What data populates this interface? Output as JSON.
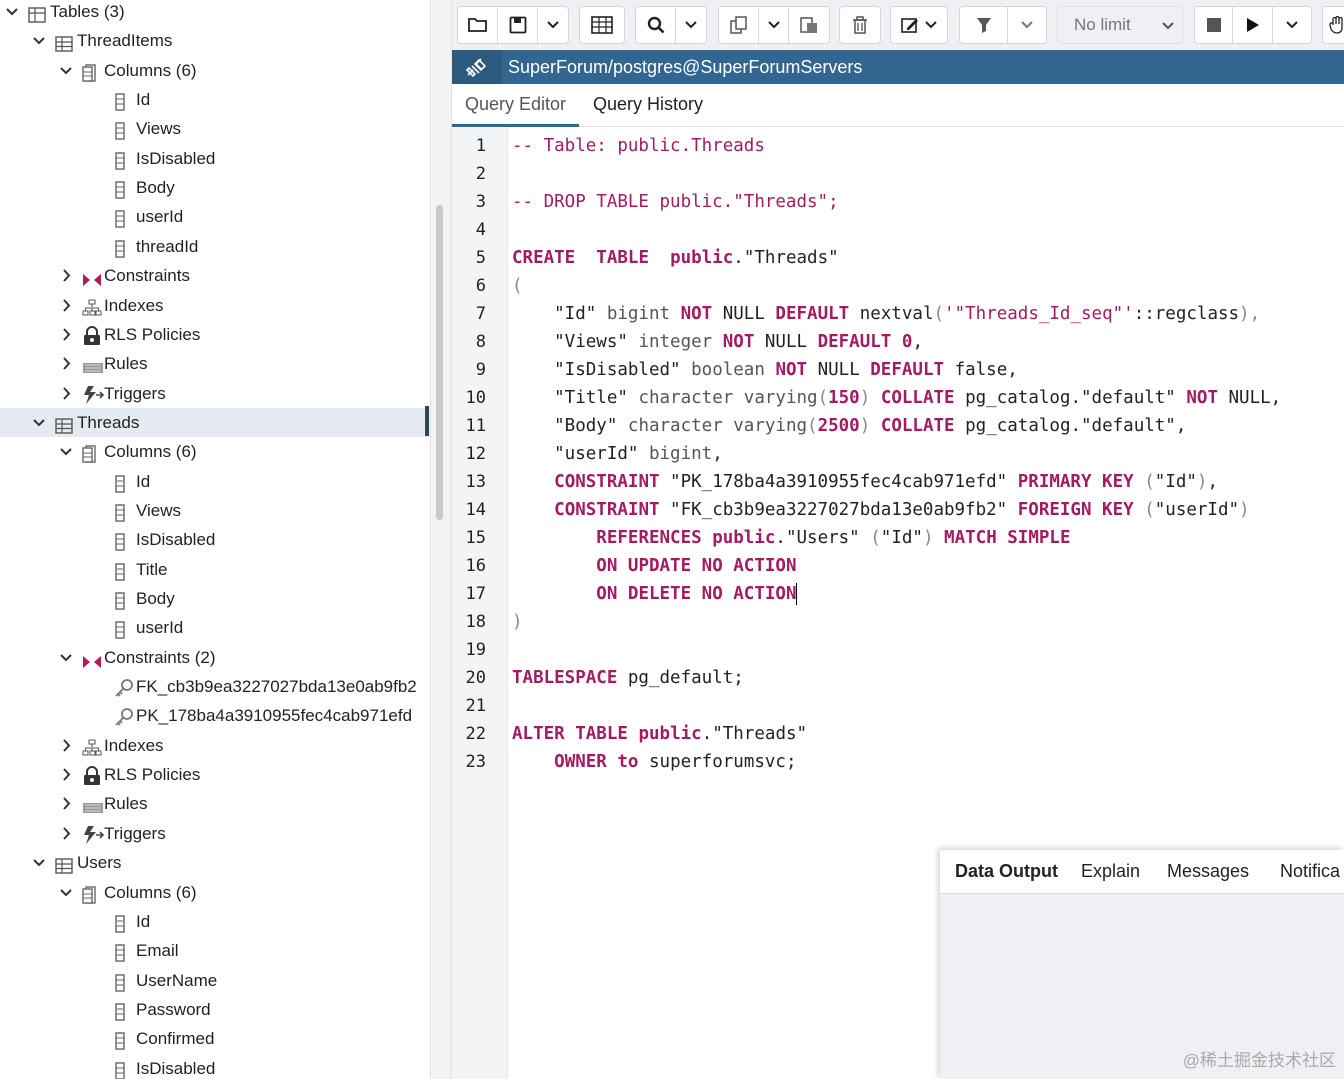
{
  "tree": {
    "rows": [
      {
        "label": "Tables (3)",
        "type": "table-group",
        "expanded": true
      },
      {
        "label": "ThreadItems",
        "type": "table",
        "expanded": true
      },
      {
        "label": "Columns (6)",
        "type": "columns",
        "expanded": true
      },
      {
        "label": "Id",
        "type": "column"
      },
      {
        "label": "Views",
        "type": "column"
      },
      {
        "label": "IsDisabled",
        "type": "column"
      },
      {
        "label": "Body",
        "type": "column"
      },
      {
        "label": "userId",
        "type": "column"
      },
      {
        "label": "threadId",
        "type": "column"
      },
      {
        "label": "Constraints",
        "type": "constraints",
        "expanded": false
      },
      {
        "label": "Indexes",
        "type": "indexes",
        "expanded": false
      },
      {
        "label": "RLS Policies",
        "type": "rls",
        "expanded": false
      },
      {
        "label": "Rules",
        "type": "rules",
        "expanded": false
      },
      {
        "label": "Triggers",
        "type": "triggers",
        "expanded": false
      },
      {
        "label": "Threads",
        "type": "table",
        "expanded": true,
        "selected": true
      },
      {
        "label": "Columns (6)",
        "type": "columns",
        "expanded": true
      },
      {
        "label": "Id",
        "type": "column"
      },
      {
        "label": "Views",
        "type": "column"
      },
      {
        "label": "IsDisabled",
        "type": "column"
      },
      {
        "label": "Title",
        "type": "column"
      },
      {
        "label": "Body",
        "type": "column"
      },
      {
        "label": "userId",
        "type": "column"
      },
      {
        "label": "Constraints (2)",
        "type": "constraints",
        "expanded": true
      },
      {
        "label": "FK_cb3b9ea3227027bda13e0ab9fb2",
        "type": "key"
      },
      {
        "label": "PK_178ba4a3910955fec4cab971efd",
        "type": "key"
      },
      {
        "label": "Indexes",
        "type": "indexes",
        "expanded": false
      },
      {
        "label": "RLS Policies",
        "type": "rls",
        "expanded": false
      },
      {
        "label": "Rules",
        "type": "rules",
        "expanded": false
      },
      {
        "label": "Triggers",
        "type": "triggers",
        "expanded": false
      },
      {
        "label": "Users",
        "type": "table",
        "expanded": true
      },
      {
        "label": "Columns (6)",
        "type": "columns",
        "expanded": true
      },
      {
        "label": "Id",
        "type": "column"
      },
      {
        "label": "Email",
        "type": "column"
      },
      {
        "label": "UserName",
        "type": "column"
      },
      {
        "label": "Password",
        "type": "column"
      },
      {
        "label": "Confirmed",
        "type": "column"
      },
      {
        "label": "IsDisabled",
        "type": "column"
      }
    ]
  },
  "toolbar": {
    "limit_label": "No limit"
  },
  "connection": {
    "title": "SuperForum/postgres@SuperForumServers"
  },
  "tabs": [
    {
      "label": "Query Editor",
      "active": true
    },
    {
      "label": "Query History",
      "active": false
    }
  ],
  "editor": {
    "line_numbers": [
      "1",
      "2",
      "3",
      "4",
      "5",
      "6",
      "7",
      "8",
      "9",
      "10",
      "11",
      "12",
      "13",
      "14",
      "15",
      "16",
      "17",
      "18",
      "19",
      "20",
      "21",
      "22",
      "23"
    ],
    "lines": [
      [
        [
          "cm",
          "-- Table: public.Threads"
        ]
      ],
      [],
      [
        [
          "cm",
          "-- DROP TABLE public.\"Threads\";"
        ]
      ],
      [],
      [
        [
          "kw",
          "CREATE"
        ],
        [
          "",
          "  "
        ],
        [
          "kw",
          "TABLE"
        ],
        [
          "",
          "  "
        ],
        [
          "kw",
          "public"
        ],
        [
          "",
          ".\"Threads\""
        ]
      ],
      [
        [
          "pn",
          "("
        ]
      ],
      [
        [
          "",
          "    \"Id\" "
        ],
        [
          "ty",
          "bigint"
        ],
        [
          "",
          " "
        ],
        [
          "kw",
          "NOT"
        ],
        [
          "",
          " NULL "
        ],
        [
          "kw",
          "DEFAULT"
        ],
        [
          "",
          " nextval"
        ],
        [
          "pn",
          "("
        ],
        [
          "st",
          "'\"Threads_Id_seq\"'"
        ],
        [
          "",
          "::regclass"
        ],
        [
          "pn",
          "),"
        ]
      ],
      [
        [
          "",
          "    \"Views\" "
        ],
        [
          "ty",
          "integer"
        ],
        [
          "",
          " "
        ],
        [
          "kw",
          "NOT"
        ],
        [
          "",
          " NULL "
        ],
        [
          "kw",
          "DEFAULT"
        ],
        [
          "",
          " "
        ],
        [
          "nm",
          "0"
        ],
        [
          "",
          ","
        ]
      ],
      [
        [
          "",
          "    \"IsDisabled\" "
        ],
        [
          "ty",
          "boolean"
        ],
        [
          "",
          " "
        ],
        [
          "kw",
          "NOT"
        ],
        [
          "",
          " NULL "
        ],
        [
          "kw",
          "DEFAULT"
        ],
        [
          "",
          " false,"
        ]
      ],
      [
        [
          "",
          "    \"Title\" "
        ],
        [
          "ty",
          "character varying"
        ],
        [
          "pn",
          "("
        ],
        [
          "nm",
          "150"
        ],
        [
          "pn",
          ")"
        ],
        [
          "",
          " "
        ],
        [
          "kw",
          "COLLATE"
        ],
        [
          "",
          " pg_catalog.\"default\" "
        ],
        [
          "kw",
          "NOT"
        ],
        [
          "",
          " NULL,"
        ]
      ],
      [
        [
          "",
          "    \"Body\" "
        ],
        [
          "ty",
          "character varying"
        ],
        [
          "pn",
          "("
        ],
        [
          "nm",
          "2500"
        ],
        [
          "pn",
          ")"
        ],
        [
          "",
          " "
        ],
        [
          "kw",
          "COLLATE"
        ],
        [
          "",
          " pg_catalog.\"default\","
        ]
      ],
      [
        [
          "",
          "    \"userId\" "
        ],
        [
          "ty",
          "bigint"
        ],
        [
          "",
          ","
        ]
      ],
      [
        [
          "",
          "    "
        ],
        [
          "kw",
          "CONSTRAINT"
        ],
        [
          "",
          " \"PK_178ba4a3910955fec4cab971efd\" "
        ],
        [
          "kw",
          "PRIMARY KEY"
        ],
        [
          "",
          " "
        ],
        [
          "pn",
          "("
        ],
        [
          "",
          "\"Id\""
        ],
        [
          "pn",
          ")"
        ],
        [
          "",
          ","
        ]
      ],
      [
        [
          "",
          "    "
        ],
        [
          "kw",
          "CONSTRAINT"
        ],
        [
          "",
          " \"FK_cb3b9ea3227027bda13e0ab9fb2\" "
        ],
        [
          "kw",
          "FOREIGN KEY"
        ],
        [
          "",
          " "
        ],
        [
          "pn",
          "("
        ],
        [
          "",
          "\"userId\""
        ],
        [
          "pn",
          ")"
        ]
      ],
      [
        [
          "",
          "        "
        ],
        [
          "kw",
          "REFERENCES"
        ],
        [
          "",
          " "
        ],
        [
          "kw",
          "public"
        ],
        [
          "",
          ".\"Users\" "
        ],
        [
          "pn",
          "("
        ],
        [
          "",
          "\"Id\""
        ],
        [
          "pn",
          ")"
        ],
        [
          "",
          " "
        ],
        [
          "kw",
          "MATCH SIMPLE"
        ]
      ],
      [
        [
          "",
          "        "
        ],
        [
          "kw",
          "ON UPDATE NO ACTION"
        ]
      ],
      [
        [
          "",
          "        "
        ],
        [
          "kw",
          "ON DELETE NO ACTION"
        ]
      ],
      [
        [
          "pn",
          ")"
        ]
      ],
      [],
      [
        [
          "kw",
          "TABLESPACE"
        ],
        [
          "",
          " pg_default;"
        ]
      ],
      [],
      [
        [
          "kw",
          "ALTER"
        ],
        [
          "",
          " "
        ],
        [
          "kw",
          "TABLE"
        ],
        [
          "",
          " "
        ],
        [
          "kw",
          "public"
        ],
        [
          "",
          ".\"Threads\""
        ]
      ],
      [
        [
          "",
          "    "
        ],
        [
          "kw",
          "OWNER"
        ],
        [
          "",
          " "
        ],
        [
          "kw",
          "to"
        ],
        [
          "",
          " superforumsvc;"
        ]
      ]
    ]
  },
  "output": {
    "tabs": [
      {
        "label": "Data Output",
        "active": true
      },
      {
        "label": "Explain",
        "active": false
      },
      {
        "label": "Messages",
        "active": false
      },
      {
        "label": "Notifica",
        "active": false
      }
    ],
    "watermark": "@稀土掘金技术社区"
  },
  "colors": {
    "keyword": "#a31c63",
    "connection_bar": "#326690",
    "selected_row": "#e6ebf1"
  }
}
